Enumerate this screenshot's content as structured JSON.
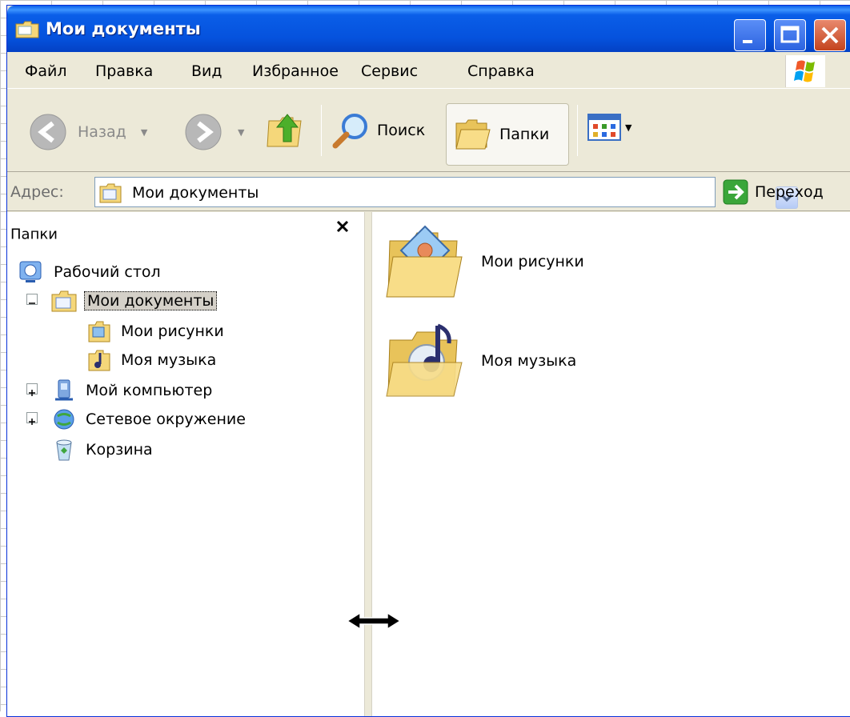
{
  "window": {
    "title": "Мои документы",
    "controls": {
      "minimize": "minimize",
      "maximize": "maximize",
      "close": "close"
    }
  },
  "menu": {
    "items": [
      "Файл",
      "Правка",
      "Вид",
      "Избранное",
      "Сервис",
      "Справка"
    ]
  },
  "toolbar": {
    "back_label": "Назад",
    "search_label": "Поиск",
    "folders_label": "Папки"
  },
  "address": {
    "label": "Адрес:",
    "value": "Мои документы",
    "go_label": "Переход"
  },
  "folder_pane": {
    "title": "Папки",
    "tree": [
      {
        "label": "Рабочий стол",
        "icon": "desktop-icon"
      },
      {
        "label": "Мои документы",
        "icon": "my-documents-icon",
        "selected": true,
        "expanded": true
      },
      {
        "label": "Мои рисунки",
        "icon": "my-pictures-icon"
      },
      {
        "label": "Моя музыка",
        "icon": "my-music-icon"
      },
      {
        "label": "Мой компьютер",
        "icon": "my-computer-icon",
        "expandable": true
      },
      {
        "label": "Сетевое окружение",
        "icon": "network-places-icon",
        "expandable": true
      },
      {
        "label": "Корзина",
        "icon": "recycle-bin-icon"
      }
    ]
  },
  "content": {
    "items": [
      {
        "label": "Мои рисунки",
        "icon": "my-pictures-folder-icon"
      },
      {
        "label": "Моя музыка",
        "icon": "my-music-folder-icon"
      }
    ]
  },
  "colors": {
    "titlebar": "#0552dd",
    "chrome": "#ece9d8",
    "selection": "#d4d0c8"
  }
}
